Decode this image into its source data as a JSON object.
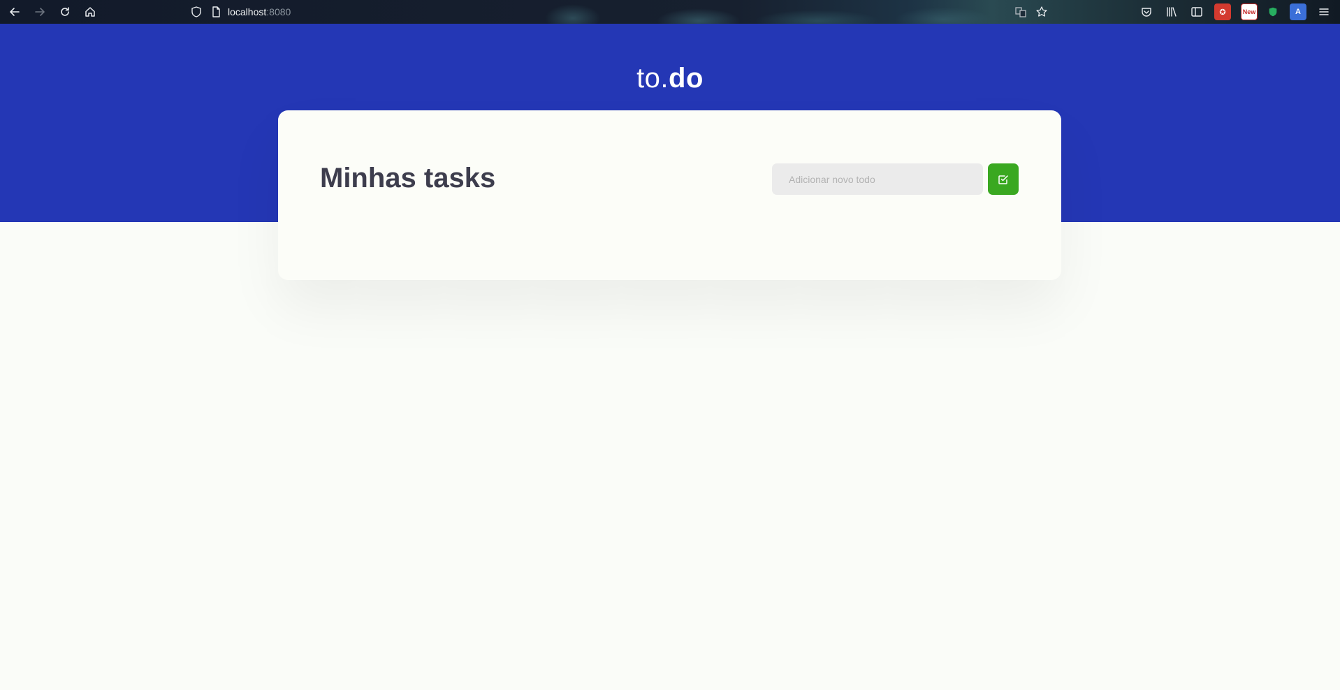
{
  "browser": {
    "url_host": "localhost",
    "url_port": ":8080",
    "new_badge": "New"
  },
  "header": {
    "logo_light": "to.",
    "logo_bold": "do"
  },
  "tasks": {
    "title": "Minhas tasks",
    "new_todo_placeholder": "Adicionar novo todo",
    "new_todo_value": ""
  },
  "colors": {
    "header_blue": "#2437b5",
    "add_button_green": "#3aa821",
    "title_text": "#3d3d4d"
  },
  "icons": {
    "add_button": "check-square-icon"
  }
}
